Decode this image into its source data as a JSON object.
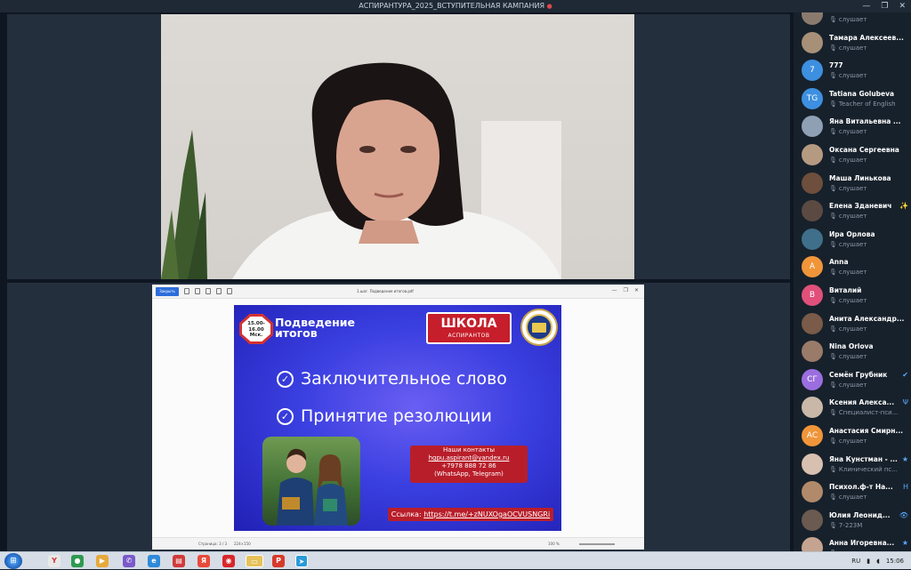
{
  "window": {
    "title": "АСПИРАНТУРА_2025_ВСТУПИТЕЛЬНАЯ КАМПАНИЯ",
    "recording_dot": "●",
    "controls": [
      "—",
      "❐",
      "✕"
    ]
  },
  "viewer": {
    "back_button": "Закрыть",
    "filename": "1.шаг. Подведение итогов.pdf",
    "zoom": "100 %",
    "page": "Страница: 3 / 3",
    "status_extra": "224×150"
  },
  "slide": {
    "badge": [
      "15.00-",
      "16.00",
      "Мск."
    ],
    "title": [
      "Подведение",
      "итогов"
    ],
    "school_title": "ШКОЛА",
    "school_sub": "АСПИРАНТОВ",
    "points": [
      "Заключительное слово",
      "Принятие резолюции"
    ],
    "check": "✓",
    "contacts_title": "Наши контакты",
    "email": "hgpu.aspirant@yandex.ru",
    "phone": "+7978 888 72 86",
    "messengers": "(WhatsApp, Telegram)",
    "link_label": "Ссылка:",
    "link_url": "https://t.me/+zNUXOgaOCVUSNGRi"
  },
  "participants": [
    {
      "name": "",
      "status": "слушает",
      "initials": "",
      "color": "#8a7a6e"
    },
    {
      "name": "Тамара Алексеев...",
      "status": "слушает",
      "initials": "",
      "color": "#a89078"
    },
    {
      "name": "777",
      "status": "слушает",
      "initials": "7",
      "color": "#3d8fe0"
    },
    {
      "name": "Tatiana Golubeva",
      "status": "Teacher of English",
      "initials": "TG",
      "color": "#3d8fe0"
    },
    {
      "name": "Яна Витальевна ...",
      "status": "слушает",
      "initials": "",
      "color": "#8fa0b5"
    },
    {
      "name": "Оксана Сергеевна",
      "status": "слушает",
      "initials": "",
      "color": "#b59a82"
    },
    {
      "name": "Маша Линькова",
      "status": "слушает",
      "initials": "",
      "color": "#6e4e3c"
    },
    {
      "name": "Елена Зданевич",
      "status": "слушает",
      "initials": "",
      "color": "#5a4a42",
      "badge": "✨"
    },
    {
      "name": "Ира Орлова",
      "status": "слушает",
      "initials": "",
      "color": "#3f6f8a"
    },
    {
      "name": "Anna",
      "status": "слушает",
      "initials": "A",
      "color": "#f0953a"
    },
    {
      "name": "Виталий",
      "status": "слушает",
      "initials": "В",
      "color": "#e0507a"
    },
    {
      "name": "Анита Александр...",
      "status": "слушает",
      "initials": "",
      "color": "#7a5a48"
    },
    {
      "name": "Nina Orlova",
      "status": "слушает",
      "initials": "",
      "color": "#9a7a68"
    },
    {
      "name": "Семён Грубник",
      "status": "слушает",
      "initials": "СГ",
      "color": "#9b6ee0",
      "badge": "✔"
    },
    {
      "name": "Ксения Алекса...",
      "status": "Специалист-пси...",
      "initials": "",
      "color": "#c9b8a8",
      "badge": "Ψ"
    },
    {
      "name": "Анастасия Смирн...",
      "status": "слушает",
      "initials": "АС",
      "color": "#f0953a"
    },
    {
      "name": "Яна Кунстман - ...",
      "status": "Клинический пс...",
      "initials": "",
      "color": "#d8c0b0",
      "badge": "★"
    },
    {
      "name": "Психол.ф-т На...",
      "status": "слушает",
      "initials": "",
      "color": "#b08a6a",
      "badge": "Н"
    },
    {
      "name": "Юлия Леонид...",
      "status": "7-223М",
      "initials": "",
      "color": "#6a5a50",
      "badge": "👁"
    },
    {
      "name": "Анна Игоревна...",
      "status": "слушает",
      "initials": "",
      "color": "#c4a490",
      "badge": "★"
    }
  ],
  "taskbar": {
    "start": "⊞",
    "lang": "RU",
    "time": "15:06"
  }
}
